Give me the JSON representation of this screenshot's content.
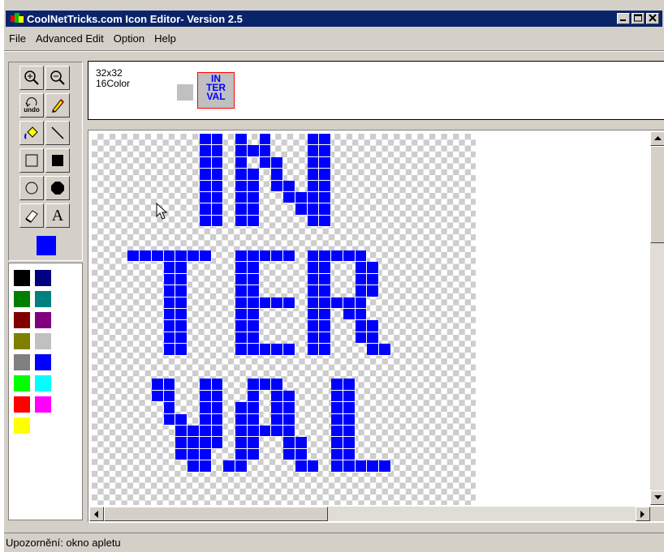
{
  "window": {
    "title": "CoolNetTricks.com Icon Editor- Version 2.5"
  },
  "menu": [
    "File",
    "Advanced Edit",
    "Option",
    "Help"
  ],
  "tools": [
    {
      "icon": "zoom-in-icon"
    },
    {
      "icon": "zoom-out-icon"
    },
    {
      "icon": "undo-icon",
      "label": "undo"
    },
    {
      "icon": "pencil-icon"
    },
    {
      "icon": "fill-bucket-icon"
    },
    {
      "icon": "line-icon"
    },
    {
      "icon": "rectangle-outline-icon"
    },
    {
      "icon": "rectangle-filled-icon"
    },
    {
      "icon": "ellipse-outline-icon"
    },
    {
      "icon": "ellipse-filled-icon"
    },
    {
      "icon": "eraser-icon"
    },
    {
      "icon": "text-icon",
      "label": "A"
    }
  ],
  "current_color": "#0000ff",
  "palette": [
    "#000000",
    "#000080",
    "#008000",
    "#008080",
    "#800000",
    "#800080",
    "#808000",
    "#c0c0c0",
    "#808080",
    "#0000ff",
    "#00ff00",
    "#00ffff",
    "#ff0000",
    "#ff00ff",
    "#ffff00"
  ],
  "info": {
    "size": "32x32",
    "colors": "16Color",
    "preview_lines": [
      "IN",
      "TER",
      "VAL"
    ]
  },
  "status": "Upozornění: okno apletu"
}
